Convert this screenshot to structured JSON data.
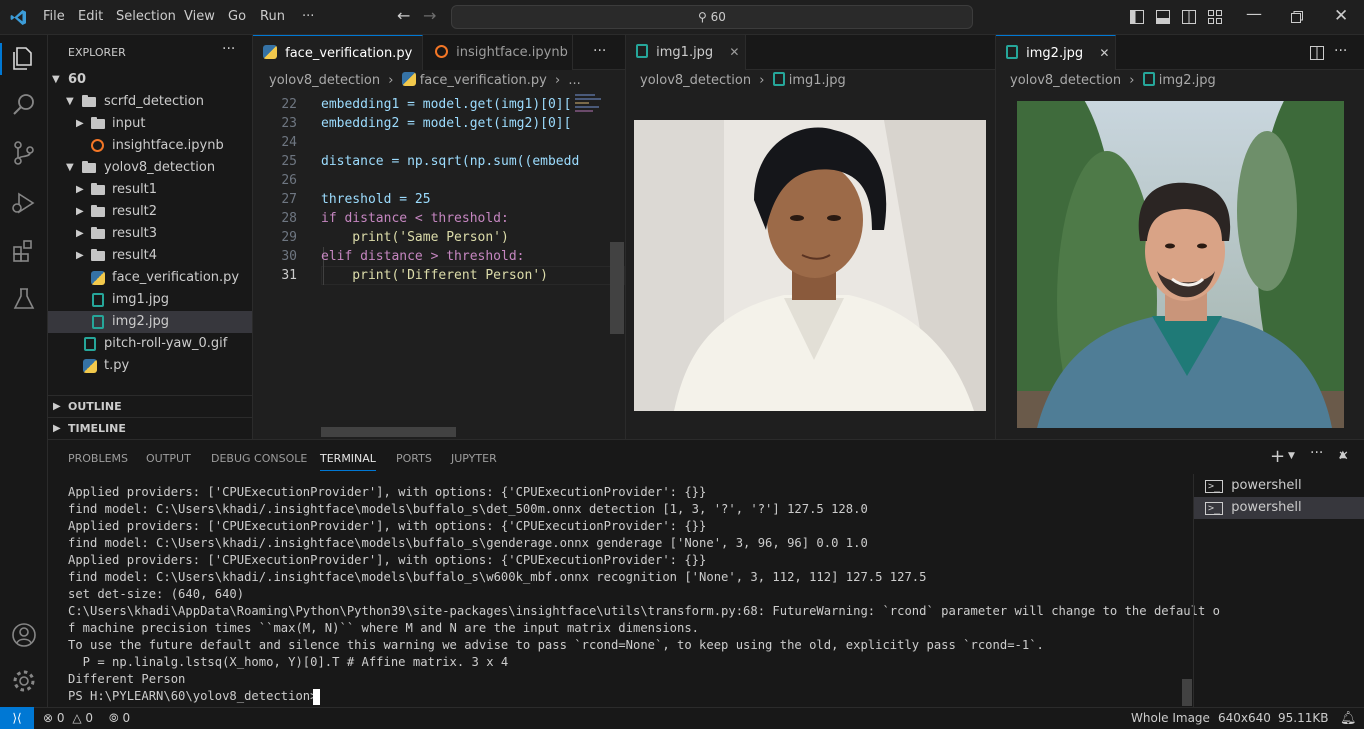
{
  "titlebar": {
    "menu": [
      "File",
      "Edit",
      "Selection",
      "View",
      "Go",
      "Run",
      "···"
    ],
    "search": "60"
  },
  "explorer": {
    "title": "EXPLORER",
    "root": "60",
    "items": [
      {
        "label": "scrfd_detection",
        "type": "folder",
        "open": true,
        "depth": 1
      },
      {
        "label": "input",
        "type": "folder",
        "open": false,
        "depth": 2
      },
      {
        "label": "insightface.ipynb",
        "type": "notebook",
        "depth": 2
      },
      {
        "label": "yolov8_detection",
        "type": "folder",
        "open": true,
        "depth": 1
      },
      {
        "label": "result1",
        "type": "folder",
        "open": false,
        "depth": 2
      },
      {
        "label": "result2",
        "type": "folder",
        "open": false,
        "depth": 2
      },
      {
        "label": "result3",
        "type": "folder",
        "open": false,
        "depth": 2
      },
      {
        "label": "result4",
        "type": "folder",
        "open": false,
        "depth": 2
      },
      {
        "label": "face_verification.py",
        "type": "python",
        "depth": 2
      },
      {
        "label": "img1.jpg",
        "type": "image",
        "depth": 2
      },
      {
        "label": "img2.jpg",
        "type": "image",
        "depth": 2,
        "selected": true
      },
      {
        "label": "pitch-roll-yaw_0.gif",
        "type": "image",
        "depth": 1
      },
      {
        "label": "t.py",
        "type": "python",
        "depth": 1
      }
    ],
    "outline": "OUTLINE",
    "timeline": "TIMELINE"
  },
  "editor1": {
    "tabs": [
      {
        "label": "face_verification.py",
        "active": true
      },
      {
        "label": "insightface.ipynb",
        "active": false
      }
    ],
    "breadcrumb": [
      "yolov8_detection",
      "face_verification.py",
      "..."
    ],
    "lines": [
      {
        "n": "22",
        "code": "embedding1 = model.get(img1)[0]["
      },
      {
        "n": "23",
        "code": "embedding2 = model.get(img2)[0]["
      },
      {
        "n": "24",
        "code": ""
      },
      {
        "n": "25",
        "code": "distance = np.sqrt(np.sum((embedd"
      },
      {
        "n": "26",
        "code": ""
      },
      {
        "n": "27",
        "code": "threshold = 25"
      },
      {
        "n": "28",
        "code": "if distance < threshold:"
      },
      {
        "n": "29",
        "code": "    print('Same Person')"
      },
      {
        "n": "30",
        "code": "elif distance > threshold:"
      },
      {
        "n": "31",
        "code": "    print('Different Person')"
      }
    ]
  },
  "editor2": {
    "tab": "img1.jpg",
    "breadcrumb": [
      "yolov8_detection",
      "img1.jpg"
    ]
  },
  "editor3": {
    "tab": "img2.jpg",
    "breadcrumb": [
      "yolov8_detection",
      "img2.jpg"
    ]
  },
  "panel": {
    "tabs": [
      "PROBLEMS",
      "OUTPUT",
      "DEBUG CONSOLE",
      "TERMINAL",
      "PORTS",
      "JUPYTER"
    ],
    "active_tab": "TERMINAL",
    "terminal_lines": [
      "Applied providers: ['CPUExecutionProvider'], with options: {'CPUExecutionProvider': {}}",
      "find model: C:\\Users\\khadi/.insightface\\models\\buffalo_s\\det_500m.onnx detection [1, 3, '?', '?'] 127.5 128.0",
      "Applied providers: ['CPUExecutionProvider'], with options: {'CPUExecutionProvider': {}}",
      "find model: C:\\Users\\khadi/.insightface\\models\\buffalo_s\\genderage.onnx genderage ['None', 3, 96, 96] 0.0 1.0",
      "Applied providers: ['CPUExecutionProvider'], with options: {'CPUExecutionProvider': {}}",
      "find model: C:\\Users\\khadi/.insightface\\models\\buffalo_s\\w600k_mbf.onnx recognition ['None', 3, 112, 112] 127.5 127.5",
      "set det-size: (640, 640)",
      "C:\\Users\\khadi\\AppData\\Roaming\\Python\\Python39\\site-packages\\insightface\\utils\\transform.py:68: FutureWarning: `rcond` parameter will change to the default o",
      "f machine precision times ``max(M, N)`` where M and N are the input matrix dimensions.",
      "To use the future default and silence this warning we advise to pass `rcond=None`, to keep using the old, explicitly pass `rcond=-1`.",
      "  P = np.linalg.lstsq(X_homo, Y)[0].T # Affine matrix. 3 x 4",
      "Different Person",
      "PS H:\\PYLEARN\\60\\yolov8_detection> "
    ],
    "shells": [
      "powershell",
      "powershell"
    ]
  },
  "status": {
    "errors": "0",
    "warnings": "0",
    "ports": "0",
    "view_mode": "Whole Image",
    "dimensions": "640x640",
    "size": "95.11KB"
  }
}
